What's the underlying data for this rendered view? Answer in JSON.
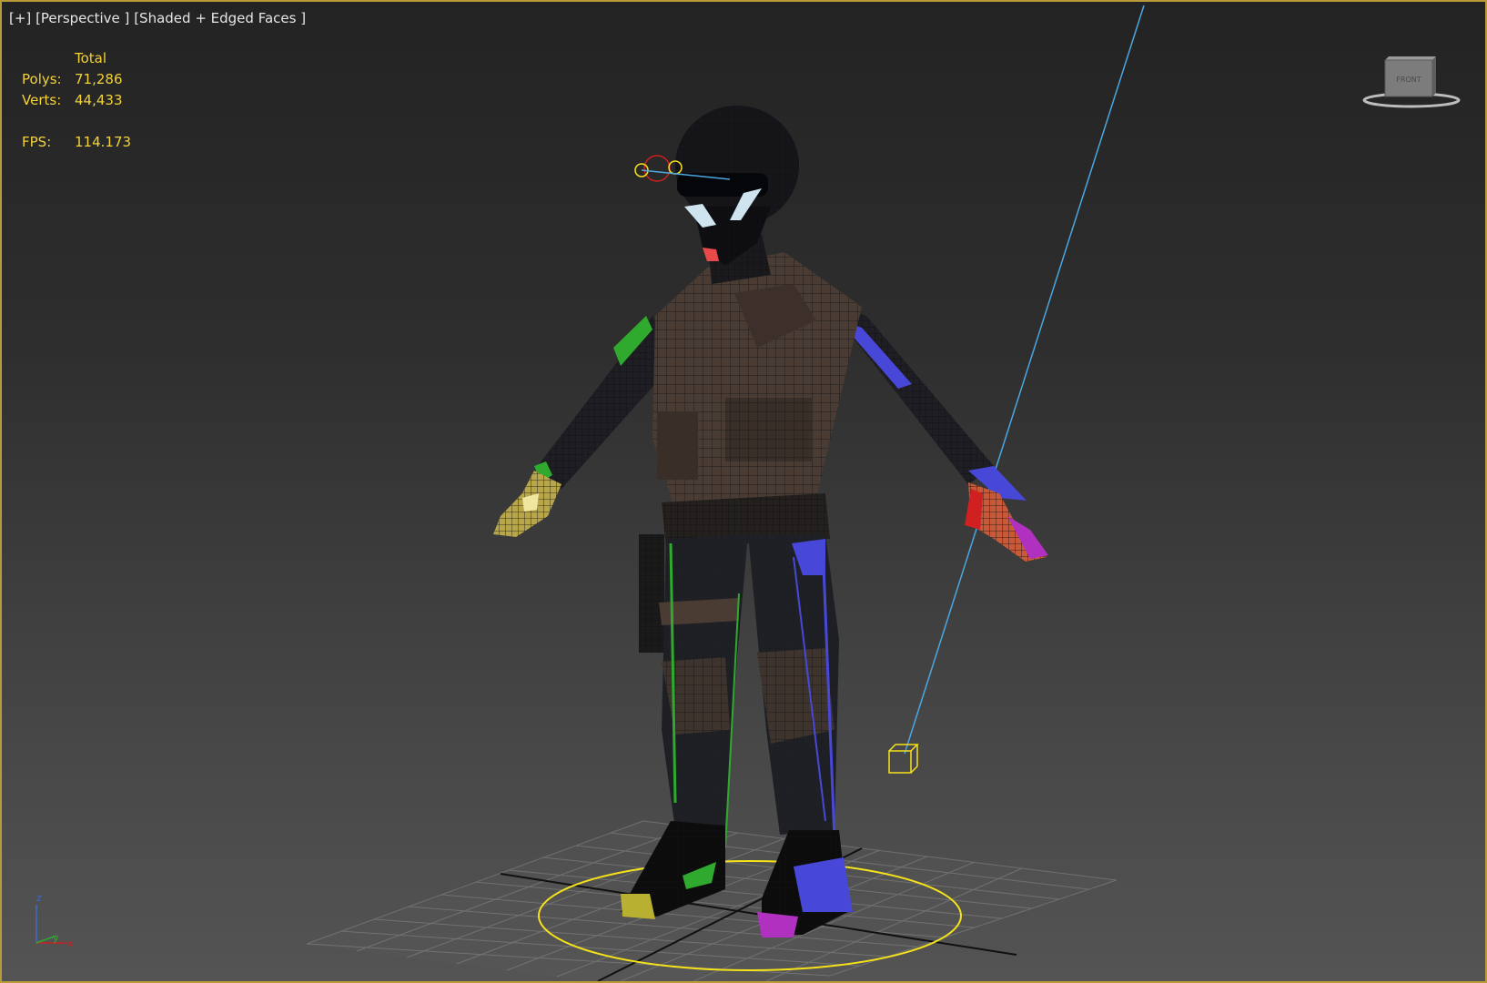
{
  "viewport": {
    "label_plus": "[+]",
    "label_view": "[Perspective ]",
    "label_shading": "[Shaded + Edged Faces ]"
  },
  "stats": {
    "header": "Total",
    "polys_label": "Polys:",
    "polys_value": "71,286",
    "verts_label": "Verts:",
    "verts_value": "44,433",
    "fps_label": "FPS:",
    "fps_value": "114.173"
  },
  "viewcube": {
    "face_label": "FRONT"
  },
  "axis": {
    "z": "z",
    "y": "y",
    "x": "x"
  },
  "colors": {
    "border": "#b99a3a",
    "stats_text": "#f3d23a",
    "selection": "#f5e21a",
    "light_line": "#4aa8e0"
  }
}
